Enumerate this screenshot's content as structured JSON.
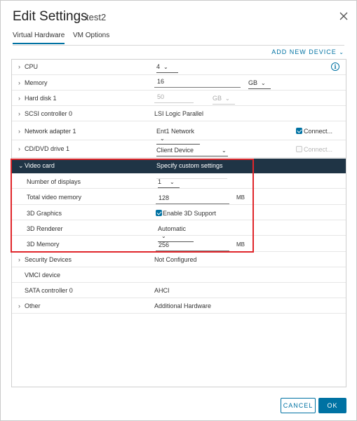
{
  "dialog": {
    "title": "Edit Settings",
    "vm_name": "test2",
    "close_icon": "close-icon"
  },
  "tabs": [
    {
      "label": "Virtual Hardware",
      "active": true
    },
    {
      "label": "VM Options",
      "active": false
    }
  ],
  "add_device": "ADD NEW DEVICE",
  "rows": {
    "cpu": {
      "label": "CPU",
      "value": "4"
    },
    "memory": {
      "label": "Memory",
      "value": "16",
      "unit": "GB"
    },
    "hard_disk": {
      "label": "Hard disk 1",
      "value": "50",
      "unit": "GB"
    },
    "scsi": {
      "label": "SCSI controller 0",
      "value": "LSI Logic Parallel"
    },
    "network": {
      "label": "Network adapter 1",
      "value": "Ent1 Network",
      "connect_label": "Connect...",
      "connected": true
    },
    "cddvd": {
      "label": "CD/DVD drive 1",
      "value": "Client Device",
      "connect_label": "Connect...",
      "connected": false
    },
    "video": {
      "label": "Video card",
      "value": "Specify custom settings"
    },
    "displays": {
      "label": "Number of displays",
      "value": "1"
    },
    "video_memory": {
      "label": "Total video memory",
      "value": "128",
      "unit": "MB"
    },
    "graphics_3d": {
      "label": "3D Graphics",
      "checkbox_label": "Enable 3D Support",
      "checked": true
    },
    "renderer": {
      "label": "3D Renderer",
      "value": "Automatic"
    },
    "memory_3d": {
      "label": "3D Memory",
      "value": "256",
      "unit": "MB"
    },
    "security": {
      "label": "Security Devices",
      "value": "Not Configured"
    },
    "vmci": {
      "label": "VMCI device"
    },
    "sata": {
      "label": "SATA controller 0",
      "value": "AHCI"
    },
    "other": {
      "label": "Other",
      "value": "Additional Hardware"
    }
  },
  "buttons": {
    "cancel": "CANCEL",
    "ok": "OK"
  },
  "colors": {
    "accent": "#0072a3",
    "selected_row": "#1f3445",
    "highlight_border": "#e0262b"
  }
}
